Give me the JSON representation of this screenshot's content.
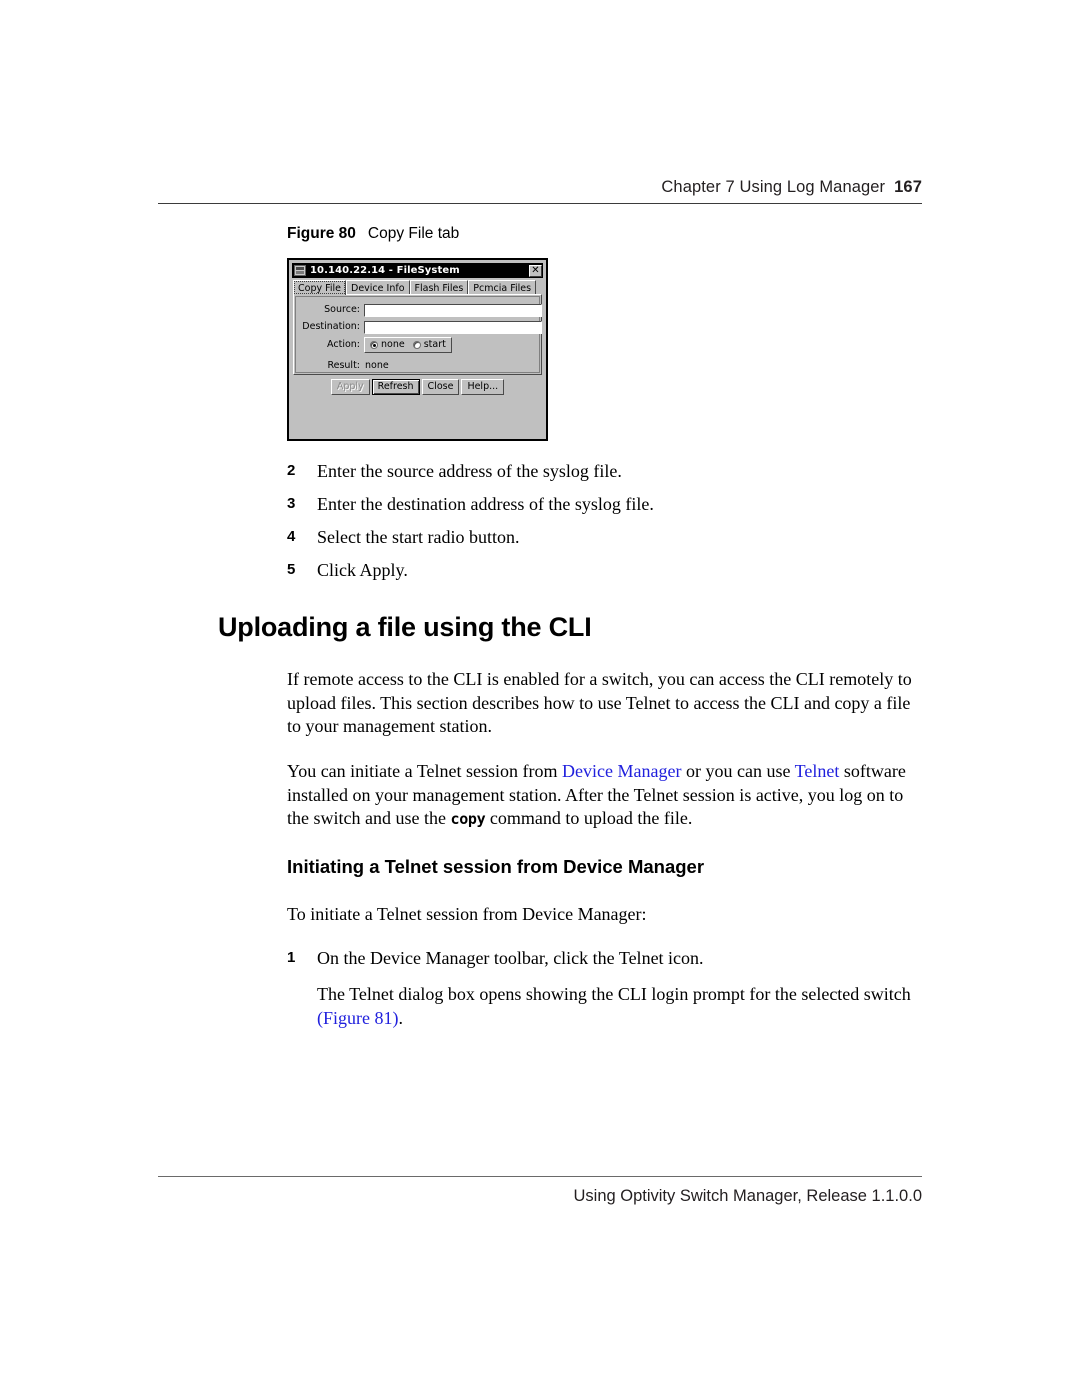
{
  "header": {
    "chapter": "Chapter 7  Using Log Manager",
    "page_number": "167"
  },
  "figure_caption": {
    "label": "Figure 80",
    "title": "Copy File tab"
  },
  "dialog": {
    "title": "10.140.22.14 - FileSystem",
    "close_glyph": "✕",
    "icon": "filesystem-window-icon",
    "tabs": [
      {
        "label": "Copy File",
        "selected": true
      },
      {
        "label": "Device Info",
        "selected": false
      },
      {
        "label": "Flash Files",
        "selected": false
      },
      {
        "label": "Pcmcia Files",
        "selected": false
      }
    ],
    "fields": {
      "source_label": "Source:",
      "source_value": "",
      "destination_label": "Destination:",
      "destination_value": "",
      "action_label": "Action:",
      "action_options": [
        {
          "label": "none",
          "selected": true
        },
        {
          "label": "start",
          "selected": false
        }
      ],
      "result_label": "Result:",
      "result_value": "none"
    },
    "buttons": [
      {
        "label": "Apply",
        "state": "disabled"
      },
      {
        "label": "Refresh",
        "state": "focused"
      },
      {
        "label": "Close",
        "state": "normal"
      },
      {
        "label": "Help...",
        "state": "normal"
      }
    ]
  },
  "steps_a": [
    {
      "num": "2",
      "text": "Enter the source address of the syslog file."
    },
    {
      "num": "3",
      "text": "Enter the destination address of the syslog file."
    },
    {
      "num": "4",
      "text": "Select the start radio button."
    },
    {
      "num": "5",
      "text": "Click Apply."
    }
  ],
  "heading_1": "Uploading a file using the CLI",
  "para_intro": "If remote access to the CLI is enabled for a switch, you can access the CLI remotely to upload files. This section describes how to use Telnet to access the CLI and copy a file to your management station.",
  "para_telnet": {
    "part1": "You can initiate a Telnet session from ",
    "link1": "Device Manager",
    "part2": " or you can use ",
    "link2": "Telnet",
    "part3": " software installed on your management station. After the Telnet session is active, you log on to the switch and use the ",
    "code": "copy",
    "part4": " command to upload the file."
  },
  "heading_2": "Initiating a Telnet session from Device Manager",
  "para_toinit": "To initiate a Telnet session from Device Manager:",
  "steps_b": [
    {
      "num": "1",
      "text": "On the Device Manager toolbar, click the Telnet icon."
    }
  ],
  "para_follow": {
    "part1": "The Telnet dialog box opens showing the CLI login prompt for the selected switch ",
    "link": "(Figure 81)",
    "part2": "."
  },
  "footer": {
    "text": "Using Optivity Switch Manager, Release 1.1.0.0"
  },
  "colors": {
    "link": "#2020dd",
    "dialog_face": "#c0c0c0",
    "titlebar": "#000000",
    "text": "#000000"
  }
}
